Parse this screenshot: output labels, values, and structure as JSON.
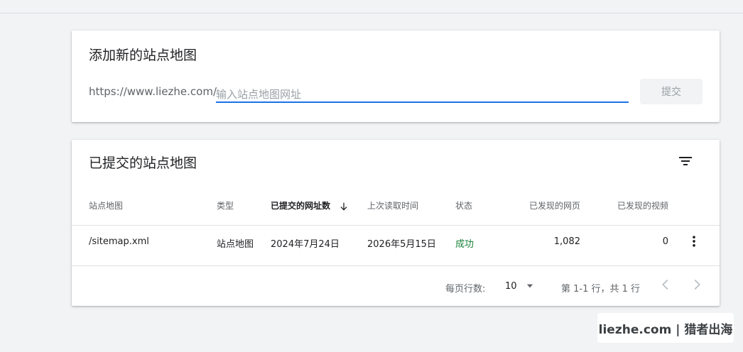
{
  "add_card": {
    "title": "添加新的站点地图",
    "url_prefix": "https://www.liezhe.com/",
    "input_value": "",
    "input_placeholder": "输入站点地图网址",
    "submit_label": "提交"
  },
  "submitted_card": {
    "title": "已提交的站点地图",
    "filter_icon": "filter-list-icon",
    "columns": [
      "站点地图",
      "类型",
      "已提交的网址数",
      "上次读取时间",
      "状态",
      "已发现的网页",
      "已发现的视频"
    ],
    "sorted_column": "已提交的网址数",
    "sort_icon": "arrow-downward-icon",
    "rows": [
      {
        "sitemap": "/sitemap.xml",
        "type": "站点地图",
        "submitted": "2024年7月24日",
        "last_read": "2026年5月15日",
        "status": "成功",
        "pages": "1,082",
        "videos": "0"
      }
    ],
    "row_menu_icon": "more-vert-icon",
    "pagination": {
      "rows_per_page_label": "每页行数:",
      "rows_per_page_value": "10",
      "range_text": "第 1-1 行，共 1 行",
      "prev_icon": "chevron-left-icon",
      "next_icon": "chevron-right-icon"
    }
  },
  "colors": {
    "accent": "#1a73e8",
    "success": "#188038",
    "background": "#f1f3f4",
    "muted_text": "#5f6368"
  },
  "watermark": "liezhe.com | 猎者出海"
}
